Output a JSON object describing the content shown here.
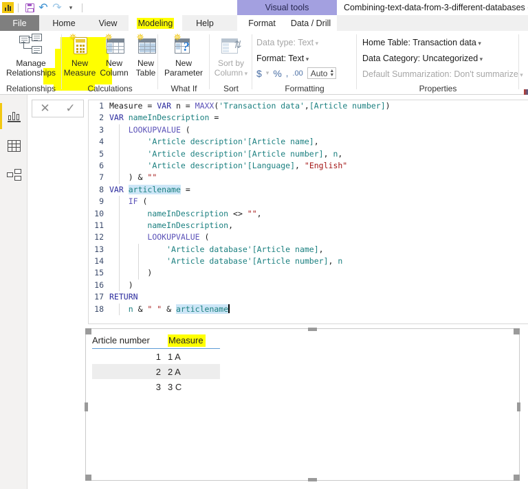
{
  "window": {
    "title": "Combining-text-data-from-3-different-databases -",
    "contextual_tab_group": "Visual tools",
    "app_icon": "power-bi-logo"
  },
  "quick_access": {
    "items": [
      {
        "name": "save-icon",
        "label": "Save"
      },
      {
        "name": "undo-icon",
        "label": "Undo"
      },
      {
        "name": "redo-icon",
        "label": "Redo"
      },
      {
        "name": "customize-qat-icon",
        "label": "Customize Quick Access Toolbar"
      }
    ]
  },
  "tabs": {
    "file": "File",
    "main": [
      {
        "label": "Home",
        "active": false,
        "highlighted": false
      },
      {
        "label": "View",
        "active": false,
        "highlighted": false
      },
      {
        "label": "Modeling",
        "active": true,
        "highlighted": true
      },
      {
        "label": "Help",
        "active": false,
        "highlighted": false
      }
    ],
    "contextual": [
      {
        "label": "Format"
      },
      {
        "label": "Data / Drill"
      }
    ]
  },
  "ribbon": {
    "groups": [
      {
        "label": "Relationships"
      },
      {
        "label": "Calculations"
      },
      {
        "label": "What If"
      },
      {
        "label": "Sort"
      },
      {
        "label": "Formatting"
      },
      {
        "label": "Properties"
      }
    ],
    "buttons": {
      "manage_relationships": {
        "line1": "Manage",
        "line2": "Relationships",
        "icon": "manage-relationships-icon",
        "enabled": true
      },
      "new_measure": {
        "line1": "New",
        "line2": "Measure",
        "icon": "new-measure-icon",
        "enabled": true,
        "highlighted": true
      },
      "new_column": {
        "line1": "New",
        "line2": "Column",
        "icon": "new-column-icon",
        "enabled": true
      },
      "new_table": {
        "line1": "New",
        "line2": "Table",
        "icon": "new-table-icon",
        "enabled": true
      },
      "new_parameter": {
        "line1": "New",
        "line2": "Parameter",
        "icon": "new-parameter-icon",
        "enabled": true
      },
      "sort_by_column": {
        "line1": "Sort by",
        "line2": "Column",
        "icon": "sort-by-column-icon",
        "enabled": false
      }
    },
    "formatting": {
      "data_type": "Data type: Text",
      "format": "Format: Text",
      "currency": "$",
      "percent": "%",
      "thousands": ",",
      "decimals": ".00",
      "decimal_places_value": "Auto"
    },
    "properties": {
      "home_table": "Home Table: Transaction data",
      "data_category": "Data Category: Uncategorized",
      "default_summarization": "Default Summarization: Don't summarize"
    }
  },
  "left_nav": {
    "items": [
      {
        "name": "report-view",
        "label": "Report",
        "selected": true
      },
      {
        "name": "data-view",
        "label": "Data",
        "selected": false
      },
      {
        "name": "model-view",
        "label": "Model",
        "selected": false
      }
    ]
  },
  "formula_bar": {
    "cancel_icon": "✕",
    "commit_icon": "✓",
    "lines": [
      {
        "n": "1",
        "tokens": [
          {
            "t": "Measure = ",
            "c": "plain"
          },
          {
            "t": "VAR",
            "c": "kw"
          },
          {
            "t": " n = ",
            "c": "plain"
          },
          {
            "t": "MAXX",
            "c": "func"
          },
          {
            "t": "(",
            "c": "plain"
          },
          {
            "t": "'Transaction data'",
            "c": "tbl"
          },
          {
            "t": ",",
            "c": "plain"
          },
          {
            "t": "[Article number]",
            "c": "tbl"
          },
          {
            "t": ")",
            "c": "plain"
          }
        ]
      },
      {
        "n": "2",
        "tokens": [
          {
            "t": "VAR",
            "c": "kw"
          },
          {
            "t": " ",
            "c": "plain"
          },
          {
            "t": "nameInDescription",
            "c": "var"
          },
          {
            "t": " =",
            "c": "plain"
          }
        ]
      },
      {
        "n": "3",
        "tokens": [
          {
            "t": "    ",
            "c": "plain"
          },
          {
            "t": "LOOKUPVALUE",
            "c": "func"
          },
          {
            "t": " (",
            "c": "plain"
          }
        ]
      },
      {
        "n": "4",
        "tokens": [
          {
            "t": "        ",
            "c": "plain"
          },
          {
            "t": "'Article description'",
            "c": "tbl"
          },
          {
            "t": "[Article name]",
            "c": "tbl"
          },
          {
            "t": ",",
            "c": "plain"
          }
        ]
      },
      {
        "n": "5",
        "tokens": [
          {
            "t": "        ",
            "c": "plain"
          },
          {
            "t": "'Article description'",
            "c": "tbl"
          },
          {
            "t": "[Article number]",
            "c": "tbl"
          },
          {
            "t": ", ",
            "c": "plain"
          },
          {
            "t": "n",
            "c": "var"
          },
          {
            "t": ",",
            "c": "plain"
          }
        ]
      },
      {
        "n": "6",
        "tokens": [
          {
            "t": "        ",
            "c": "plain"
          },
          {
            "t": "'Article description'",
            "c": "tbl"
          },
          {
            "t": "[Language]",
            "c": "tbl"
          },
          {
            "t": ", ",
            "c": "plain"
          },
          {
            "t": "\"English\"",
            "c": "str"
          }
        ]
      },
      {
        "n": "7",
        "tokens": [
          {
            "t": "    ) & ",
            "c": "plain"
          },
          {
            "t": "\"\"",
            "c": "str"
          }
        ]
      },
      {
        "n": "8",
        "tokens": [
          {
            "t": "VAR",
            "c": "kw"
          },
          {
            "t": " ",
            "c": "plain"
          },
          {
            "t": "articlename",
            "c": "sel"
          },
          {
            "t": " =",
            "c": "plain"
          }
        ]
      },
      {
        "n": "9",
        "tokens": [
          {
            "t": "    ",
            "c": "plain"
          },
          {
            "t": "IF",
            "c": "func"
          },
          {
            "t": " (",
            "c": "plain"
          }
        ]
      },
      {
        "n": "10",
        "tokens": [
          {
            "t": "        ",
            "c": "plain"
          },
          {
            "t": "nameInDescription",
            "c": "var"
          },
          {
            "t": " <> ",
            "c": "plain"
          },
          {
            "t": "\"\"",
            "c": "str"
          },
          {
            "t": ",",
            "c": "plain"
          }
        ]
      },
      {
        "n": "11",
        "tokens": [
          {
            "t": "        ",
            "c": "plain"
          },
          {
            "t": "nameInDescription",
            "c": "var"
          },
          {
            "t": ",",
            "c": "plain"
          }
        ]
      },
      {
        "n": "12",
        "tokens": [
          {
            "t": "        ",
            "c": "plain"
          },
          {
            "t": "LOOKUPVALUE",
            "c": "func"
          },
          {
            "t": " (",
            "c": "plain"
          }
        ]
      },
      {
        "n": "13",
        "tokens": [
          {
            "t": "            ",
            "c": "plain"
          },
          {
            "t": "'Article database'",
            "c": "tbl"
          },
          {
            "t": "[Article name]",
            "c": "tbl"
          },
          {
            "t": ",",
            "c": "plain"
          }
        ]
      },
      {
        "n": "14",
        "tokens": [
          {
            "t": "            ",
            "c": "plain"
          },
          {
            "t": "'Article database'",
            "c": "tbl"
          },
          {
            "t": "[Article number]",
            "c": "tbl"
          },
          {
            "t": ", ",
            "c": "plain"
          },
          {
            "t": "n",
            "c": "var"
          }
        ]
      },
      {
        "n": "15",
        "tokens": [
          {
            "t": "        )",
            "c": "plain"
          }
        ]
      },
      {
        "n": "16",
        "tokens": [
          {
            "t": "    )",
            "c": "plain"
          }
        ]
      },
      {
        "n": "17",
        "tokens": [
          {
            "t": "RETURN",
            "c": "kw"
          }
        ]
      },
      {
        "n": "18",
        "tokens": [
          {
            "t": "    ",
            "c": "plain"
          },
          {
            "t": "n",
            "c": "var"
          },
          {
            "t": " & ",
            "c": "plain"
          },
          {
            "t": "\" \"",
            "c": "str"
          },
          {
            "t": " & ",
            "c": "plain"
          },
          {
            "t": "articlename",
            "c": "sel"
          },
          {
            "t": "|",
            "c": "caret"
          }
        ]
      }
    ]
  },
  "visual": {
    "type": "table",
    "columns": [
      {
        "label": "Article number",
        "align": "right",
        "highlighted": false
      },
      {
        "label": "Measure",
        "align": "left",
        "highlighted": true
      }
    ],
    "rows": [
      {
        "cells": [
          "1",
          "1 A"
        ],
        "alt": false
      },
      {
        "cells": [
          "2",
          "2 A"
        ],
        "alt": true
      },
      {
        "cells": [
          "3",
          "3 C"
        ],
        "alt": false
      }
    ]
  },
  "colors": {
    "accent_yellow": "#f2c811",
    "highlight_yellow": "#ffff00",
    "contextual_purple": "#a3a0e0",
    "file_tab_gray": "#7f7f7f",
    "table_underline_blue": "#5b9bd5",
    "alt_row_gray": "#ededed"
  }
}
